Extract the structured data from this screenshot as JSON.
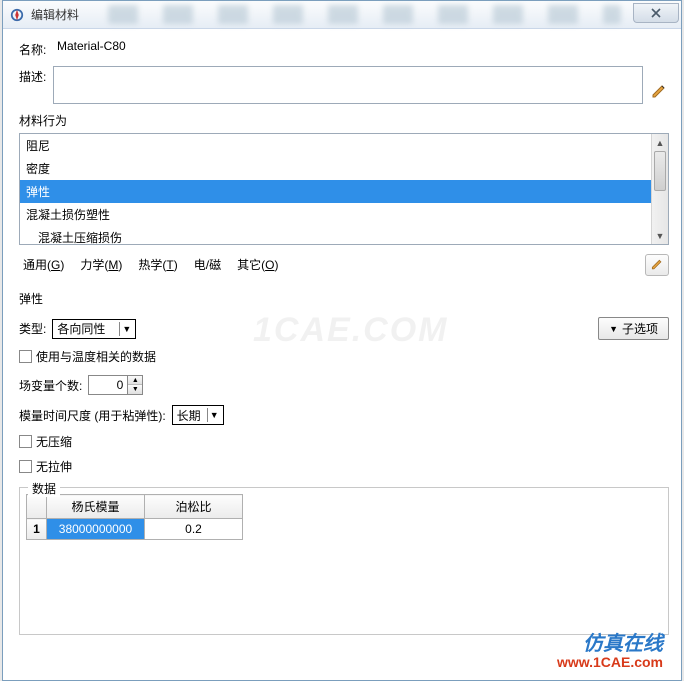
{
  "window": {
    "title": "编辑材料"
  },
  "fields": {
    "name_label": "名称:",
    "name_value": "Material-C80",
    "desc_label": "描述:"
  },
  "behavior": {
    "label": "材料行为",
    "items": [
      "阻尼",
      "密度",
      "弹性",
      "混凝土损伤塑性",
      "混凝土压缩损伤"
    ],
    "selected_index": 2
  },
  "tabs": {
    "general": "通用",
    "general_u": "G",
    "mech": "力学",
    "mech_u": "M",
    "heat": "热学",
    "heat_u": "T",
    "em": "电/磁",
    "other": "其它",
    "other_u": "O"
  },
  "elastic": {
    "title": "弹性",
    "type_label": "类型:",
    "type_value": "各向同性",
    "sub_button": "子选项",
    "dep_temp": "使用与温度相关的数据",
    "field_var_label": "场变量个数:",
    "field_var_value": "0",
    "time_scale_label": "模量时间尺度 (用于粘弹性):",
    "time_scale_value": "长期",
    "no_compress": "无压缩",
    "no_tension": "无拉伸"
  },
  "data": {
    "legend": "数据",
    "headers": [
      "杨氏模量",
      "泊松比"
    ],
    "rows": [
      {
        "n": "1",
        "v": [
          "38000000000",
          "0.2"
        ],
        "selected_col": 0
      }
    ]
  },
  "watermark": {
    "l1": "仿真在线",
    "l2": "www.1CAE.com",
    "center": "1CAE.COM"
  }
}
